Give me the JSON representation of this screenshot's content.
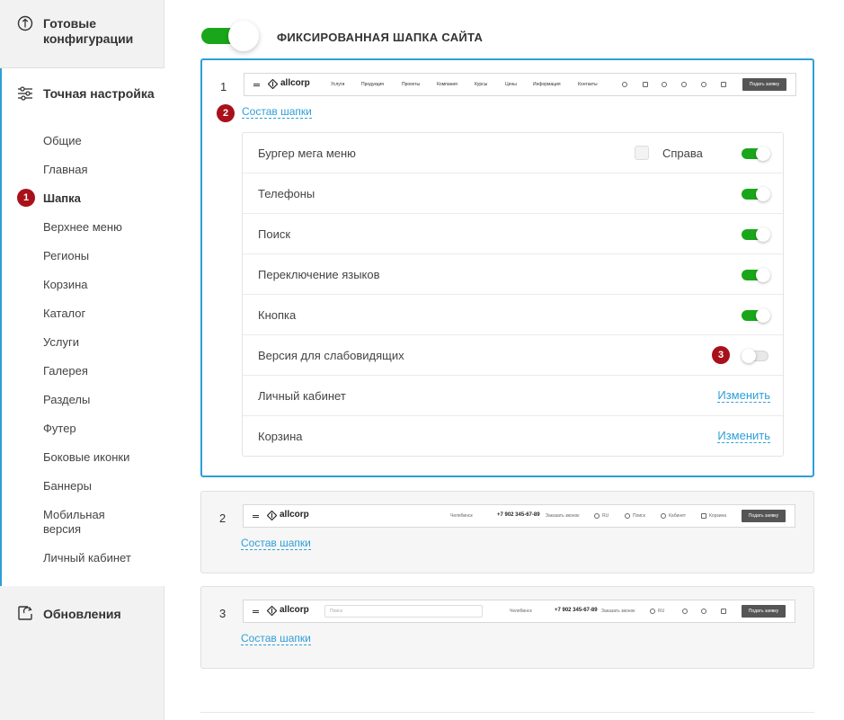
{
  "sidebar": {
    "ready_configs": "Готовые конфигурации",
    "fine_tuning": "Точная настройка",
    "updates": "Обновления",
    "items": [
      {
        "label": "Общие"
      },
      {
        "label": "Главная"
      },
      {
        "label": "Шапка",
        "active": true
      },
      {
        "label": "Верхнее меню"
      },
      {
        "label": "Регионы"
      },
      {
        "label": "Корзина"
      },
      {
        "label": "Каталог"
      },
      {
        "label": "Услуги"
      },
      {
        "label": "Галерея"
      },
      {
        "label": "Разделы"
      },
      {
        "label": "Футер"
      },
      {
        "label": "Боковые иконки"
      },
      {
        "label": "Баннеры"
      },
      {
        "label": "Мобильная версия"
      },
      {
        "label": "Личный кабинет"
      }
    ]
  },
  "badges": {
    "b1": "1",
    "b2": "2",
    "b3": "3"
  },
  "main": {
    "title": "ФИКСИРОВАННАЯ ШАПКА САЙТА",
    "fixed_header_enabled": true
  },
  "preview": {
    "logo": "allcorp",
    "menu": [
      "Услуги",
      "Продукция",
      "Проекты",
      "Компания",
      "Курсы",
      "Цены",
      "Информация",
      "Контакты"
    ],
    "button": "Подать заявку",
    "city": "Челябинск",
    "phone": "+7 902 345-67-89",
    "callback": "Заказать звонок",
    "lang": "RU",
    "search_label": "Поиск",
    "cabinet": "Кабинет",
    "cart": "Корзина",
    "search_placeholder": "Поиск"
  },
  "variants": [
    {
      "num": "1",
      "sostav": "Состав шапки"
    },
    {
      "num": "2",
      "sostav": "Состав шапки"
    },
    {
      "num": "3",
      "sostav": "Состав шапки"
    }
  ],
  "settings": {
    "burger": {
      "label": "Бургер мега меню",
      "checkbox_label": "Справа",
      "enabled": true
    },
    "phones": {
      "label": "Телефоны",
      "enabled": true
    },
    "search": {
      "label": "Поиск",
      "enabled": true
    },
    "lang": {
      "label": "Переключение языков",
      "enabled": true
    },
    "button": {
      "label": "Кнопка",
      "enabled": true
    },
    "low_vision": {
      "label": "Версия для слабовидящих",
      "enabled": false
    },
    "cabinet": {
      "label": "Личный кабинет",
      "action": "Изменить"
    },
    "cart": {
      "label": "Корзина",
      "action": "Изменить"
    }
  },
  "colors": {
    "accent": "#2e9fd8",
    "toggle_on": "#1aa61a",
    "badge": "#a8111a"
  }
}
